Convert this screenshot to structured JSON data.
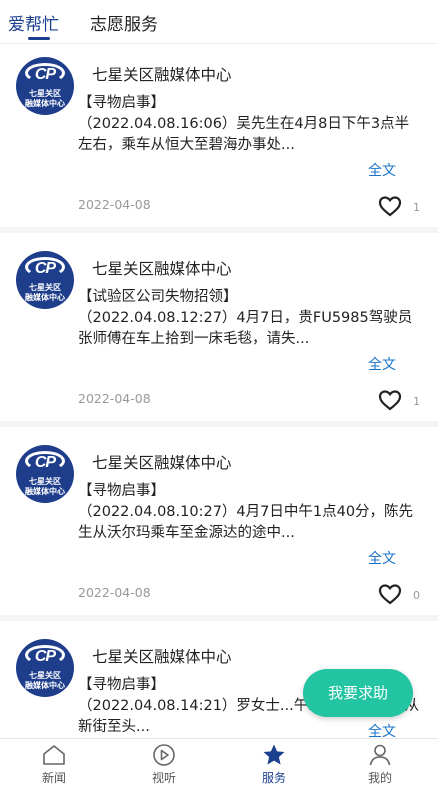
{
  "tabs": [
    {
      "label": "爱帮忙",
      "active": true
    },
    {
      "label": "志愿服务",
      "active": false
    }
  ],
  "accent_color": "#1a3f8f",
  "posts": [
    {
      "author": "七星关区融媒体中心",
      "avatar_text_1": "七星关区",
      "avatar_text_2": "融媒体中心",
      "tag": "【寻物启事】",
      "text": "（2022.04.08.16:06）吴先生在4月8日下午3点半左右，乘车从恒大至碧海办事处...",
      "more": "全文",
      "date": "2022-04-08",
      "likes": "1"
    },
    {
      "author": "七星关区融媒体中心",
      "avatar_text_1": "七星关区",
      "avatar_text_2": "融媒体中心",
      "tag": "【试验区公司失物招领】",
      "text": "（2022.04.08.12:27）4月7日，贵FU5985驾驶员张师傅在车上拾到一床毛毯，请失...",
      "more": "全文",
      "date": "2022-04-08",
      "likes": "1"
    },
    {
      "author": "七星关区融媒体中心",
      "avatar_text_1": "七星关区",
      "avatar_text_2": "融媒体中心",
      "tag": "【寻物启事】",
      "text": "（2022.04.08.10:27）4月7日中午1点40分，陈先生从沃尔玛乘车至金源达的途中...",
      "more": "全文",
      "date": "2022-04-08",
      "likes": "0"
    },
    {
      "author": "七星关区融媒体中心",
      "avatar_text_1": "七星关区",
      "avatar_text_2": "融媒体中心",
      "tag": "【寻物启事】",
      "text": "（2022.04.08.14:21）罗女士...午2点左右，乘车从新街至头...",
      "more": "全文",
      "date": "",
      "likes": ""
    }
  ],
  "fab_label": "我要求助",
  "nav": [
    {
      "label": "新闻",
      "icon": "home-icon",
      "active": false
    },
    {
      "label": "视听",
      "icon": "play-icon",
      "active": false
    },
    {
      "label": "服务",
      "icon": "star-icon",
      "active": true
    },
    {
      "label": "我的",
      "icon": "user-icon",
      "active": false
    }
  ]
}
